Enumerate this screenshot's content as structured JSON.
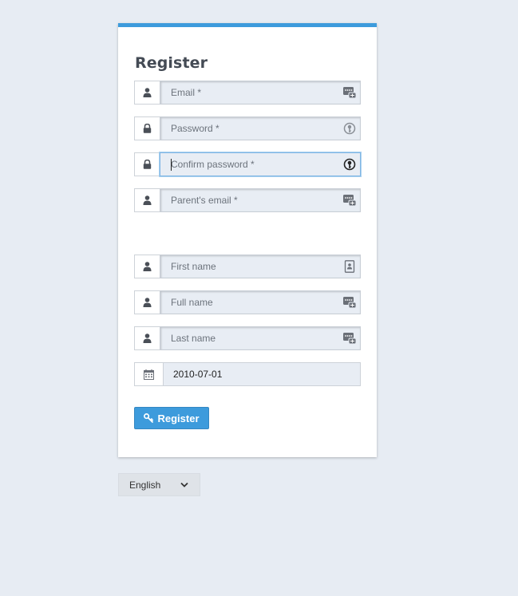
{
  "form": {
    "title": "Register",
    "fields": [
      {
        "name": "email",
        "placeholder": "Email *",
        "icon": "user-icon",
        "suffix_icon": "password-manager-icon"
      },
      {
        "name": "password",
        "placeholder": "Password *",
        "icon": "lock-icon",
        "suffix_icon": "key-manager-icon"
      },
      {
        "name": "confirm_password",
        "placeholder": "Confirm password *",
        "icon": "lock-icon",
        "suffix_icon": "key-manager-icon",
        "focused": true
      },
      {
        "name": "parent_email",
        "placeholder": "Parent's email *",
        "icon": "user-icon",
        "suffix_icon": "password-manager-icon"
      },
      {
        "name": "first_name",
        "placeholder": "First name",
        "icon": "user-icon",
        "suffix_icon": "contact-card-icon"
      },
      {
        "name": "full_name",
        "placeholder": "Full name",
        "icon": "user-icon",
        "suffix_icon": "password-manager-icon"
      },
      {
        "name": "last_name",
        "placeholder": "Last name",
        "icon": "user-icon",
        "suffix_icon": "password-manager-icon"
      },
      {
        "name": "birth_date",
        "value": "2010-07-01",
        "icon": "calendar-icon"
      }
    ],
    "submit_label": "Register",
    "submit_icon": "key-icon"
  },
  "language": {
    "selected": "English",
    "icon": "chevron-down-icon"
  },
  "colors": {
    "accent": "#3d9bdc",
    "background": "#e7ecf3",
    "input_bg": "#e8edf4"
  }
}
